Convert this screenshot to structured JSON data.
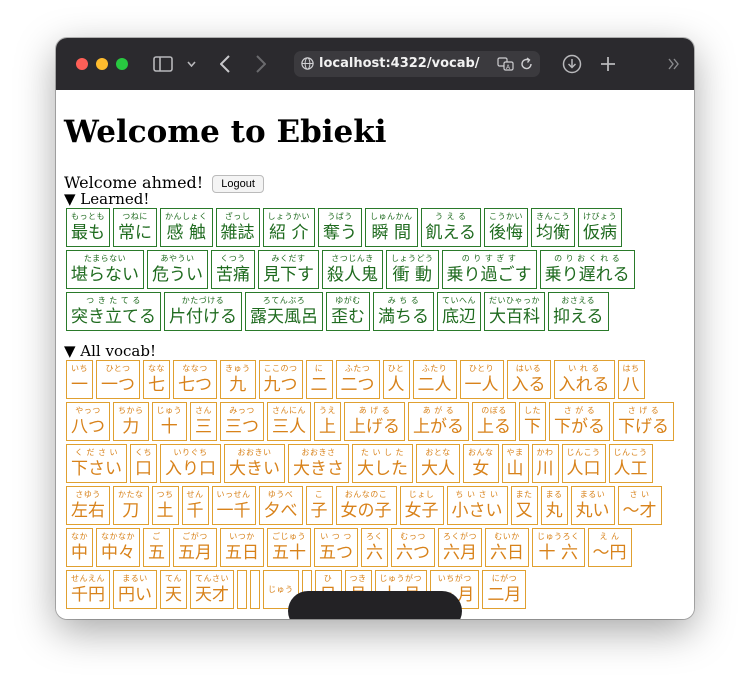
{
  "browser": {
    "url": "localhost:4322/vocab/"
  },
  "page": {
    "title": "Welcome to Ebieki",
    "welcome_text": "Welcome ahmed!",
    "logout_label": "Logout",
    "learned_summary": "▼ Learned!",
    "all_summary": "▼ All vocab!"
  },
  "learned": [
    {
      "r": "もっとも",
      "w": "最も"
    },
    {
      "r": "つねに",
      "w": "常に"
    },
    {
      "r": "かんしょく",
      "w": "感 触"
    },
    {
      "r": "ざっし",
      "w": "雑誌"
    },
    {
      "r": "しょうかい",
      "w": "紹 介"
    },
    {
      "r": "うばう",
      "w": "奪う"
    },
    {
      "r": "しゅんかん",
      "w": "瞬 間"
    },
    {
      "r": "う え る",
      "w": "飢える"
    },
    {
      "r": "こうかい",
      "w": "後悔"
    },
    {
      "r": "きんこう",
      "w": "均衡"
    },
    {
      "r": "けびょう",
      "w": "仮病"
    },
    {
      "r": "たまらない",
      "w": "堪らない"
    },
    {
      "r": "あやうい",
      "w": "危うい"
    },
    {
      "r": "くつう",
      "w": "苦痛"
    },
    {
      "r": "みくだす",
      "w": "見下す"
    },
    {
      "r": "さつじんき",
      "w": "殺人鬼"
    },
    {
      "r": "しょうどう",
      "w": "衝 動"
    },
    {
      "r": "の り す ぎ す",
      "w": "乗り過ごす"
    },
    {
      "r": "の り お く れ る",
      "w": "乗り遅れる"
    },
    {
      "r": "つ き た て る",
      "w": "突き立てる"
    },
    {
      "r": "かたづける",
      "w": "片付ける"
    },
    {
      "r": "ろてんぶろ",
      "w": "露天風呂"
    },
    {
      "r": "ゆがむ",
      "w": "歪む"
    },
    {
      "r": "み ち る",
      "w": "満ちる"
    },
    {
      "r": "ていへん",
      "w": "底辺"
    },
    {
      "r": "だいひゃっか",
      "w": "大百科"
    },
    {
      "r": "おさえる",
      "w": "抑える"
    }
  ],
  "all_vocab": [
    {
      "r": "いち",
      "w": "一"
    },
    {
      "r": "ひとつ",
      "w": "一つ"
    },
    {
      "r": "なな",
      "w": "七"
    },
    {
      "r": "ななつ",
      "w": "七つ"
    },
    {
      "r": "きゅう",
      "w": "九"
    },
    {
      "r": "ここのつ",
      "w": "九つ"
    },
    {
      "r": "に",
      "w": "二"
    },
    {
      "r": "ふたつ",
      "w": "二つ"
    },
    {
      "r": "ひと",
      "w": "人"
    },
    {
      "r": "ふたり",
      "w": "二人"
    },
    {
      "r": "ひとり",
      "w": "一人"
    },
    {
      "r": "はいる",
      "w": "入る"
    },
    {
      "r": "い れ る",
      "w": "入れる"
    },
    {
      "r": "はち",
      "w": "八"
    },
    {
      "r": "やっつ",
      "w": "八つ"
    },
    {
      "r": "ちから",
      "w": "力"
    },
    {
      "r": "じゅう",
      "w": "十"
    },
    {
      "r": "さん",
      "w": "三"
    },
    {
      "r": "みっつ",
      "w": "三つ"
    },
    {
      "r": "さんにん",
      "w": "三人"
    },
    {
      "r": "うえ",
      "w": "上"
    },
    {
      "r": "あ げ る",
      "w": "上げる"
    },
    {
      "r": "あ が る",
      "w": "上がる"
    },
    {
      "r": "のぼる",
      "w": "上る"
    },
    {
      "r": "した",
      "w": "下"
    },
    {
      "r": "さ が る",
      "w": "下がる"
    },
    {
      "r": "さ げ る",
      "w": "下げる"
    },
    {
      "r": "く だ さ い",
      "w": "下さい"
    },
    {
      "r": "くち",
      "w": "口"
    },
    {
      "r": "いりぐち",
      "w": "入り口"
    },
    {
      "r": "おおきい",
      "w": "大きい"
    },
    {
      "r": "おおきさ",
      "w": "大きさ"
    },
    {
      "r": "た い し た",
      "w": "大した"
    },
    {
      "r": "おとな",
      "w": "大人"
    },
    {
      "r": "おんな",
      "w": "女"
    },
    {
      "r": "やま",
      "w": "山"
    },
    {
      "r": "かわ",
      "w": "川"
    },
    {
      "r": "じんこう",
      "w": "人口"
    },
    {
      "r": "じんこう",
      "w": "人工"
    },
    {
      "r": "さゆう",
      "w": "左右"
    },
    {
      "r": "かたな",
      "w": "刀"
    },
    {
      "r": "つち",
      "w": "土"
    },
    {
      "r": "せん",
      "w": "千"
    },
    {
      "r": "いっせん",
      "w": "一千"
    },
    {
      "r": "ゆうべ",
      "w": "夕べ"
    },
    {
      "r": "こ",
      "w": "子"
    },
    {
      "r": "おんなのこ",
      "w": "女の子"
    },
    {
      "r": "じょし",
      "w": "女子"
    },
    {
      "r": "ち い さ い",
      "w": "小さい"
    },
    {
      "r": "また",
      "w": "又"
    },
    {
      "r": "まる",
      "w": "丸"
    },
    {
      "r": "まるい",
      "w": "丸い"
    },
    {
      "r": "さ い",
      "w": "〜才"
    },
    {
      "r": "なか",
      "w": "中"
    },
    {
      "r": "なかなか",
      "w": "中々"
    },
    {
      "r": "ご",
      "w": "五"
    },
    {
      "r": "ごがつ",
      "w": "五月"
    },
    {
      "r": "いつか",
      "w": "五日"
    },
    {
      "r": "ごじゅう",
      "w": "五十"
    },
    {
      "r": "い つ つ",
      "w": "五つ"
    },
    {
      "r": "ろく",
      "w": "六"
    },
    {
      "r": "むっつ",
      "w": "六つ"
    },
    {
      "r": "ろくがつ",
      "w": "六月"
    },
    {
      "r": "むいか",
      "w": "六日"
    },
    {
      "r": "じゅうろく",
      "w": "十 六"
    },
    {
      "r": "え ん",
      "w": "〜円"
    },
    {
      "r": "せんえん",
      "w": "千円"
    },
    {
      "r": "まるい",
      "w": "円い"
    },
    {
      "r": "てん",
      "w": "天"
    },
    {
      "r": "てんさい",
      "w": "天才"
    },
    {
      "r": "",
      "w": ""
    },
    {
      "r": "",
      "w": ""
    },
    {
      "r": "じゅう",
      "w": ""
    },
    {
      "r": "",
      "w": ""
    },
    {
      "r": "ひ",
      "w": "日"
    },
    {
      "r": "つき",
      "w": "月"
    },
    {
      "r": "じゅうがつ",
      "w": "十 月"
    },
    {
      "r": "いちがつ",
      "w": "一 月"
    },
    {
      "r": "にがつ",
      "w": "二月"
    }
  ],
  "icons": {
    "sidebar": "sidebar-icon",
    "chevron": "chevron-down-icon",
    "back": "back-arrow-icon",
    "forward": "forward-arrow-icon",
    "site": "globe-icon",
    "translate": "translate-icon",
    "reload": "reload-icon",
    "download": "download-icon",
    "newtab": "plus-icon",
    "more": "double-chevron-icon"
  }
}
